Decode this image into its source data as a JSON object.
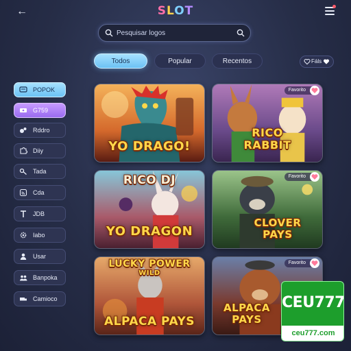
{
  "header": {
    "logo": [
      "S",
      "L",
      "O",
      "T"
    ]
  },
  "search": {
    "placeholder": "Pesquisar logos"
  },
  "tabs": [
    {
      "label": "Todos",
      "active": true
    },
    {
      "label": "Popular",
      "active": false
    },
    {
      "label": "Recentos",
      "active": false
    }
  ],
  "fav_filter": {
    "label": "Fáls"
  },
  "sidebar": {
    "items": [
      {
        "label": "POPOK",
        "icon": "chat-icon",
        "style": "primary"
      },
      {
        "label": "G759",
        "icon": "ticket-icon",
        "style": "secondary"
      },
      {
        "label": "Rddro",
        "icon": "circles-icon",
        "style": "normal"
      },
      {
        "label": "Diiy",
        "icon": "puzzle-icon",
        "style": "normal"
      },
      {
        "label": "Tada",
        "icon": "key-icon",
        "style": "normal"
      },
      {
        "label": "Cda",
        "icon": "signal-icon",
        "style": "normal"
      },
      {
        "label": "JDB",
        "icon": "t-icon",
        "style": "normal"
      },
      {
        "label": "Iabo",
        "icon": "gear-icon",
        "style": "normal"
      },
      {
        "label": "Usar",
        "icon": "user-icon",
        "style": "normal"
      },
      {
        "label": "Banpoka",
        "icon": "people-icon",
        "style": "normal"
      },
      {
        "label": "Camioco",
        "icon": "truck-icon",
        "style": "normal"
      }
    ]
  },
  "games": [
    {
      "title_lines": [
        "YO DRAGO!"
      ],
      "favorite": false,
      "badge": "",
      "theme": "dragon"
    },
    {
      "title_lines": [
        "RICO",
        "RABBIT"
      ],
      "favorite": true,
      "badge": "Favorito",
      "theme": "rabbit"
    },
    {
      "title_lines": [
        "RICO DJ",
        "YO DRAGON"
      ],
      "favorite": false,
      "badge": "",
      "theme": "bunny"
    },
    {
      "title_lines": [
        "CLOVER",
        "PAYS"
      ],
      "favorite": true,
      "badge": "Favorito",
      "theme": "bear"
    },
    {
      "title_lines": [
        "LUCKY POWER",
        "WILD",
        "ALPACA PAYS"
      ],
      "favorite": false,
      "badge": "",
      "theme": "alpaca"
    },
    {
      "title_lines": [
        "ALPACA",
        "PAYS"
      ],
      "favorite": true,
      "badge": "Favorito",
      "theme": "brownbear"
    }
  ],
  "brand": {
    "name": "CEU777",
    "url": "ceu777.com"
  },
  "colors": {
    "accent": "#6cc2f4",
    "secondary": "#9a6cf0",
    "favorite_heart": "#ff7a9a",
    "brand_green": "#1d9e2c"
  }
}
